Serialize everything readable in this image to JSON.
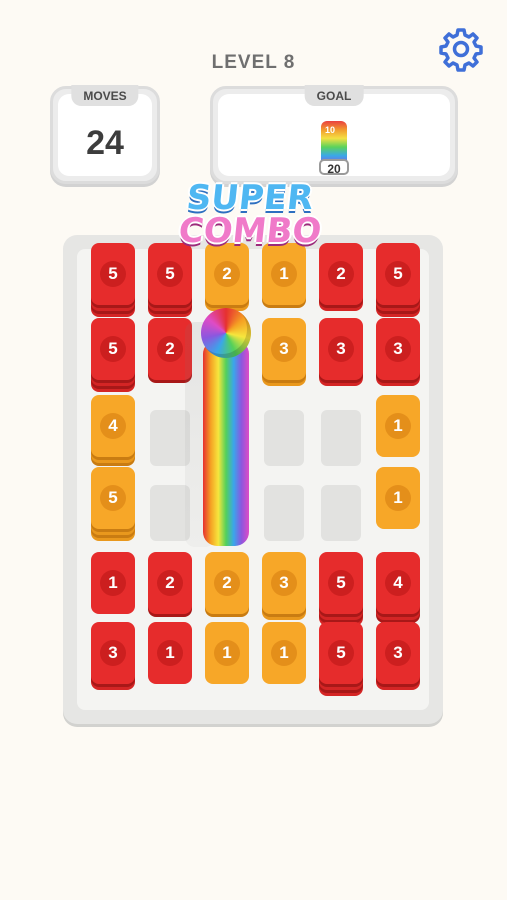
{
  "header": {
    "level_label": "LEVEL 8"
  },
  "moves": {
    "label": "MOVES",
    "value": "24"
  },
  "goal": {
    "label": "GOAL",
    "tile_top": "10",
    "tile_value": "20"
  },
  "banner": {
    "line1": "SUPER",
    "line2": "COMBO"
  },
  "board": {
    "stacks": [
      {
        "col": 0,
        "row": 0,
        "value": "5",
        "color": "red",
        "height": 5
      },
      {
        "col": 1,
        "row": 0,
        "value": "5",
        "color": "red",
        "height": 5
      },
      {
        "col": 2,
        "row": 0,
        "value": "2",
        "color": "orange",
        "height": 3
      },
      {
        "col": 3,
        "row": 0,
        "value": "1",
        "color": "orange",
        "height": 2
      },
      {
        "col": 4,
        "row": 0,
        "value": "2",
        "color": "red",
        "height": 3
      },
      {
        "col": 5,
        "row": 0,
        "value": "5",
        "color": "red",
        "height": 5
      },
      {
        "col": 0,
        "row": 1,
        "value": "5",
        "color": "red",
        "height": 5
      },
      {
        "col": 1,
        "row": 1,
        "value": "2",
        "color": "red",
        "height": 2
      },
      {
        "col": 3,
        "row": 1,
        "value": "3",
        "color": "orange",
        "height": 3
      },
      {
        "col": 4,
        "row": 1,
        "value": "3",
        "color": "red",
        "height": 3
      },
      {
        "col": 5,
        "row": 1,
        "value": "3",
        "color": "red",
        "height": 3
      },
      {
        "col": 0,
        "row": 2,
        "value": "4",
        "color": "orange",
        "height": 4
      },
      {
        "col": 5,
        "row": 2,
        "value": "1",
        "color": "orange",
        "height": 1
      },
      {
        "col": 0,
        "row": 3,
        "value": "5",
        "color": "orange",
        "height": 5
      },
      {
        "col": 5,
        "row": 3,
        "value": "1",
        "color": "orange",
        "height": 1
      },
      {
        "col": 0,
        "row": 4,
        "value": "1",
        "color": "red",
        "height": 1
      },
      {
        "col": 1,
        "row": 4,
        "value": "2",
        "color": "red",
        "height": 2
      },
      {
        "col": 2,
        "row": 4,
        "value": "2",
        "color": "orange",
        "height": 2
      },
      {
        "col": 3,
        "row": 4,
        "value": "3",
        "color": "orange",
        "height": 3
      },
      {
        "col": 4,
        "row": 4,
        "value": "5",
        "color": "red",
        "height": 5
      },
      {
        "col": 5,
        "row": 4,
        "value": "4",
        "color": "red",
        "height": 4
      },
      {
        "col": 0,
        "row": 5,
        "value": "3",
        "color": "red",
        "height": 3
      },
      {
        "col": 1,
        "row": 5,
        "value": "1",
        "color": "red",
        "height": 1
      },
      {
        "col": 2,
        "row": 5,
        "value": "1",
        "color": "orange",
        "height": 1
      },
      {
        "col": 3,
        "row": 5,
        "value": "1",
        "color": "orange",
        "height": 1
      },
      {
        "col": 4,
        "row": 5,
        "value": "5",
        "color": "red",
        "height": 5
      },
      {
        "col": 5,
        "row": 5,
        "value": "3",
        "color": "red",
        "height": 3
      }
    ],
    "empty_slots": [
      {
        "col": 1,
        "row": 2
      },
      {
        "col": 3,
        "row": 2
      },
      {
        "col": 4,
        "row": 2
      },
      {
        "col": 1,
        "row": 3
      },
      {
        "col": 3,
        "row": 3
      },
      {
        "col": 4,
        "row": 3
      }
    ]
  },
  "colors": {
    "red": "#e62c2c",
    "orange": "#f7a728",
    "background": "#fdfaf4"
  }
}
